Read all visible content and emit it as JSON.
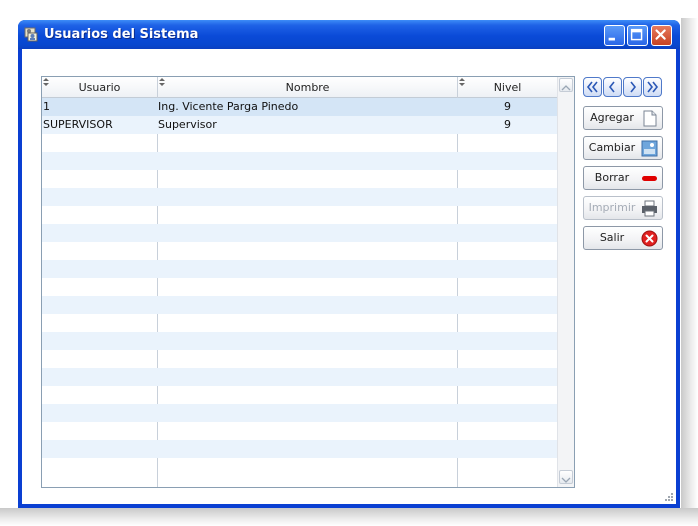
{
  "window": {
    "title": "Usuarios del Sistema",
    "titlebar_color": "#0a4ad8",
    "close_color": "#c64223"
  },
  "titlebar_buttons": [
    "minimize-icon",
    "maximize-icon",
    "close-icon"
  ],
  "grid": {
    "columns": [
      "Usuario",
      "Nombre",
      "Nivel"
    ],
    "rows": [
      {
        "usuario": "1",
        "nombre": "Ing. Vicente Parga Pinedo",
        "nivel": "9"
      },
      {
        "usuario": "SUPERVISOR",
        "nombre": "Supervisor",
        "nivel": "9"
      }
    ],
    "selected_row": 0,
    "row_alt_color": "#eaf3fc",
    "row_selected_color": "#d4e5f6"
  },
  "navigation": [
    "first-record-icon",
    "previous-record-icon",
    "next-record-icon",
    "last-record-icon"
  ],
  "actions": {
    "agregar": {
      "label": "Agregar",
      "icon": "new-document-icon",
      "enabled": true
    },
    "cambiar": {
      "label": "Cambiar",
      "icon": "edit-image-icon",
      "enabled": true
    },
    "borrar": {
      "label": "Borrar",
      "icon": "minus-bar-icon",
      "enabled": true,
      "icon_color": "#e00000"
    },
    "imprimir": {
      "label": "Imprimir",
      "icon": "printer-icon",
      "enabled": false
    },
    "salir": {
      "label": "Salir",
      "icon": "close-circle-icon",
      "enabled": true,
      "icon_color": "#e02020"
    }
  }
}
